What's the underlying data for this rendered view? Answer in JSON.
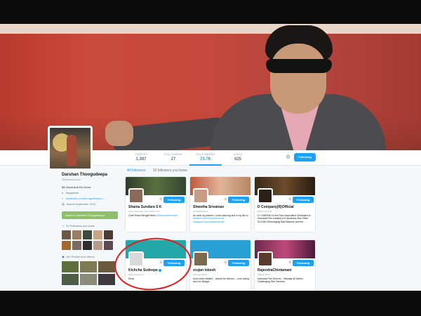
{
  "colors": {
    "accent": "#1da1f2",
    "tweet_to": "#8ec06a",
    "annotation": "#e21a1a"
  },
  "nav": {
    "stats": [
      {
        "label": "TWEETS",
        "value": "1,387"
      },
      {
        "label": "FOLLOWING",
        "value": "27"
      },
      {
        "label": "FOLLOWERS",
        "value": "73.7K"
      },
      {
        "label": "LIKES",
        "value": "625"
      }
    ],
    "gear_icon": "gear-icon",
    "follow_label": "Following"
  },
  "profile": {
    "name": "Darshan Thoogudeepa",
    "handle": "@dasadarshan",
    "bio": "Be Good And Do Good",
    "location": "Bangalore",
    "url": "facebook.com/thoogudeepa.o...",
    "joined": "Joined September 2012",
    "tweet_to": "Tweet to Darshan Thoogudeepa",
    "followers_you_know": "10 Followers you know",
    "photos_videos": "160 Photos and videos"
  },
  "tabs": {
    "all": "All followers",
    "you_know": "10 followers you know"
  },
  "cards": [
    {
      "name": "Shama Sundara S K",
      "handle": "@shamasundar",
      "follows_you": "FOLLOWS YOU",
      "bio": "Chief Editor Bengal Metro",
      "bio_link": "@DiscoverMetrokar",
      "button": "Following"
    },
    {
      "name": "Shwetha Srivatsav",
      "handle": "@ShwethaSriva",
      "bio": "An actor by passion,  Loves dancing and in my life cc",
      "bio_link": "facebook.com/shwetha.srivat... instagram.com/shwethasrivat...",
      "button": "Following"
    },
    {
      "name": "D Company(R)Official",
      "handle": "@DCompanyR",
      "bio": "D COMPANY is the Fans Association Dedicated to Kannada Film Industry's #1 Business Box Office SULTAN Dhanvegrag Bad Badman and the...",
      "button": "Following"
    },
    {
      "name": "Kichcha Sudeepa",
      "handle": "@KicchaSudeep",
      "bio": "Kiccs",
      "button": "Following"
    },
    {
      "name": "srujan lokesh",
      "handle": "@srujanlokesh",
      "bio": "Actor loves theatre... wanna be director... Love acting and our Bangal...",
      "button": "Following"
    },
    {
      "name": "RajendraChintamani",
      "handle": "@Rajendrach",
      "bio": "Kannada Film Director... Manage all writers, Challenging Star Darshan",
      "button": "Following"
    }
  ]
}
